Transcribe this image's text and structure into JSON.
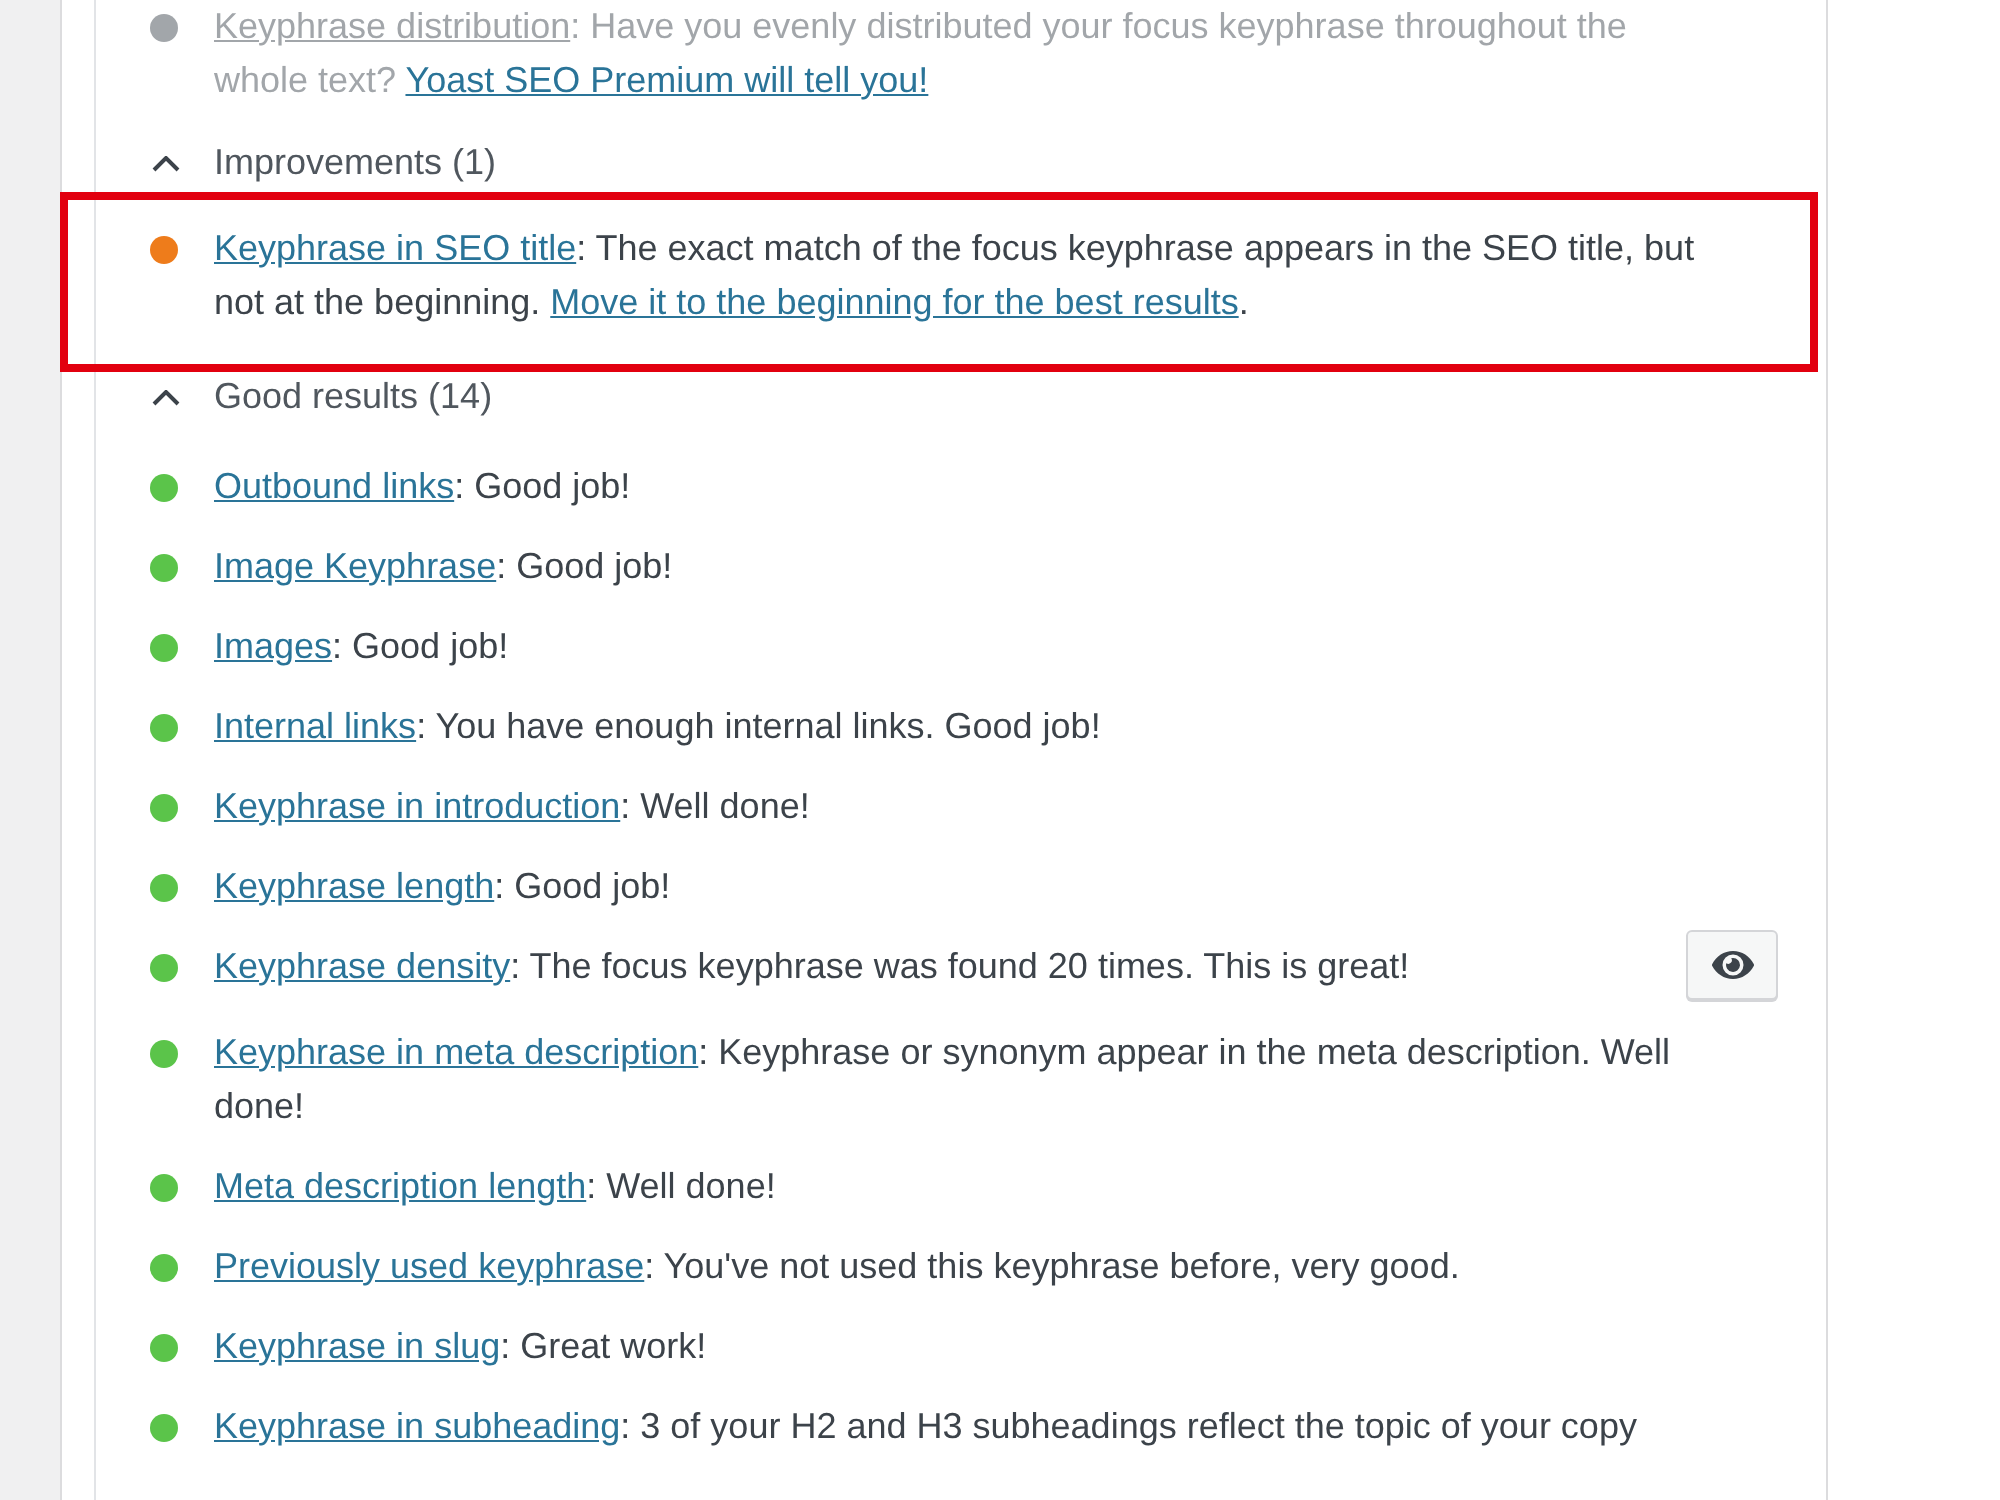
{
  "upsell": {
    "color": "#a2a6aa",
    "disabled": true,
    "parts": [
      {
        "kind": "link",
        "text": "Keyphrase distribution"
      },
      {
        "kind": "text",
        "text": ": Have you evenly distributed your focus keyphrase throughout the whole text? "
      },
      {
        "kind": "upsell_link",
        "text": "Yoast SEO Premium will tell you!"
      }
    ]
  },
  "sections": [
    {
      "title": "Improvements (1)",
      "expanded": true,
      "items": [
        {
          "color": "#ee7c1b",
          "highlighted": true,
          "parts": [
            {
              "kind": "link",
              "text": "Keyphrase in SEO title"
            },
            {
              "kind": "text",
              "text": ": The exact match of the focus keyphrase appears in the SEO title, but not at the beginning. "
            },
            {
              "kind": "link",
              "text": "Move it to the beginning for the best results"
            },
            {
              "kind": "text",
              "text": "."
            }
          ]
        }
      ]
    },
    {
      "title": "Good results (14)",
      "expanded": true,
      "items": [
        {
          "color": "#5bc44a",
          "highlighted": false,
          "parts": [
            {
              "kind": "link",
              "text": "Outbound links"
            },
            {
              "kind": "text",
              "text": ": Good job!"
            }
          ]
        },
        {
          "color": "#5bc44a",
          "highlighted": false,
          "parts": [
            {
              "kind": "link",
              "text": "Image Keyphrase"
            },
            {
              "kind": "text",
              "text": ": Good job!"
            }
          ]
        },
        {
          "color": "#5bc44a",
          "highlighted": false,
          "parts": [
            {
              "kind": "link",
              "text": "Images"
            },
            {
              "kind": "text",
              "text": ": Good job!"
            }
          ]
        },
        {
          "color": "#5bc44a",
          "highlighted": false,
          "parts": [
            {
              "kind": "link",
              "text": "Internal links"
            },
            {
              "kind": "text",
              "text": ": You have enough internal links. Good job!"
            }
          ]
        },
        {
          "color": "#5bc44a",
          "highlighted": false,
          "parts": [
            {
              "kind": "link",
              "text": "Keyphrase in introduction"
            },
            {
              "kind": "text",
              "text": ": Well done!"
            }
          ]
        },
        {
          "color": "#5bc44a",
          "highlighted": false,
          "parts": [
            {
              "kind": "link",
              "text": "Keyphrase length"
            },
            {
              "kind": "text",
              "text": ": Good job!"
            }
          ]
        },
        {
          "color": "#5bc44a",
          "highlighted": false,
          "eye_button": true,
          "parts": [
            {
              "kind": "link",
              "text": "Keyphrase density"
            },
            {
              "kind": "text",
              "text": ": The focus keyphrase was found 20 times. This is great!"
            }
          ]
        },
        {
          "color": "#5bc44a",
          "highlighted": false,
          "parts": [
            {
              "kind": "link",
              "text": "Keyphrase in meta description"
            },
            {
              "kind": "text",
              "text": ": Keyphrase or synonym appear in the meta description. Well done!"
            }
          ]
        },
        {
          "color": "#5bc44a",
          "highlighted": false,
          "parts": [
            {
              "kind": "link",
              "text": "Meta description length"
            },
            {
              "kind": "text",
              "text": ": Well done!"
            }
          ]
        },
        {
          "color": "#5bc44a",
          "highlighted": false,
          "parts": [
            {
              "kind": "link",
              "text": "Previously used keyphrase"
            },
            {
              "kind": "text",
              "text": ": You've not used this keyphrase before, very good."
            }
          ]
        },
        {
          "color": "#5bc44a",
          "highlighted": false,
          "parts": [
            {
              "kind": "link",
              "text": "Keyphrase in slug"
            },
            {
              "kind": "text",
              "text": ": Great work!"
            }
          ]
        },
        {
          "color": "#5bc44a",
          "highlighted": false,
          "parts": [
            {
              "kind": "link",
              "text": "Keyphrase in subheading"
            },
            {
              "kind": "text",
              "text": ": 3 of your H2 and H3 subheadings reflect the topic of your copy"
            }
          ]
        }
      ]
    }
  ]
}
